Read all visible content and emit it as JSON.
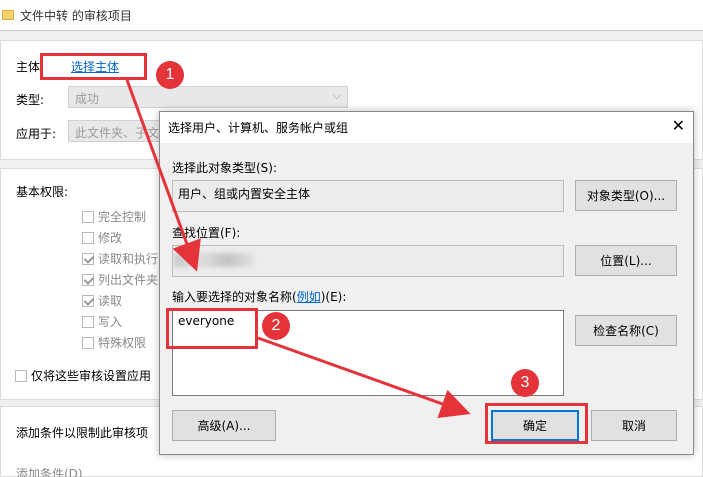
{
  "window": {
    "title": "文件中转 的审核项目"
  },
  "principal": {
    "label": "主体:",
    "link": "选择主体"
  },
  "type": {
    "label": "类型:",
    "value": "成功"
  },
  "applies_to": {
    "label": "应用于:",
    "value": "此文件夹、子文"
  },
  "basic_permissions": {
    "label": "基本权限:",
    "items": [
      {
        "label": "完全控制",
        "checked": false
      },
      {
        "label": "修改",
        "checked": false
      },
      {
        "label": "读取和执行",
        "checked": true
      },
      {
        "label": "列出文件夹",
        "checked": true
      },
      {
        "label": "读取",
        "checked": true
      },
      {
        "label": "写入",
        "checked": false
      },
      {
        "label": "特殊权限",
        "checked": false
      }
    ]
  },
  "only_apply": {
    "label": "仅将这些审核设置应用"
  },
  "conditions": {
    "label": "添加条件以限制此审核项",
    "add_link": "添加条件(D)"
  },
  "dialog": {
    "title": "选择用户、计算机、服务帐户或组",
    "object_type_label": "选择此对象类型(S):",
    "object_type_value": "用户、组或内置安全主体",
    "object_type_button": "对象类型(O)...",
    "location_label": "查找位置(F):",
    "location_button": "位置(L)...",
    "names_label_prefix": "输入要选择的对象名称(",
    "names_label_link": "例如",
    "names_label_suffix": ")(E):",
    "names_value": "everyone",
    "check_names_button": "检查名称(C)",
    "advanced_button": "高级(A)...",
    "ok_button": "确定",
    "cancel_button": "取消",
    "close_icon": "close-icon"
  },
  "annotations": {
    "step1": "1",
    "step2": "2",
    "step3": "3",
    "color": "#e5333a"
  }
}
